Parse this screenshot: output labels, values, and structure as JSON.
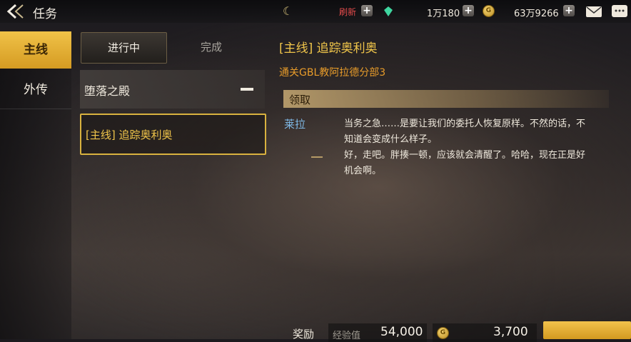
{
  "header": {
    "title": "任务",
    "refresh_label": "刷新",
    "currency1": "1万180",
    "currency2": "63万9266"
  },
  "nav": {
    "items": [
      "主线",
      "外传"
    ]
  },
  "tabs": [
    "进行中",
    "完成"
  ],
  "quest_list": {
    "group": "堕落之殿",
    "item": "[主线] 追踪奥利奥"
  },
  "detail": {
    "title": "[主线] 追踪奥利奥",
    "objective": "通关GBL教阿拉德分部3",
    "section": "领取",
    "speaker": "莱拉",
    "dialog": [
      "当务之急……是要让我们的委托人恢复原样。不然的话，不知道会变成什么样子。",
      "好，走吧。胖揍一顿，应该就会清醒了。哈哈，现在正是好机会啊。"
    ]
  },
  "reward": {
    "label": "奖励",
    "exp_label": "经验值",
    "exp_value": "54,000",
    "gold_value": "3,700"
  },
  "colors": {
    "accent_gold": "#f0c54a",
    "objective_orange": "#e89c2a",
    "speaker_blue": "#7fb9e6",
    "refresh_red": "#e24b4b"
  }
}
